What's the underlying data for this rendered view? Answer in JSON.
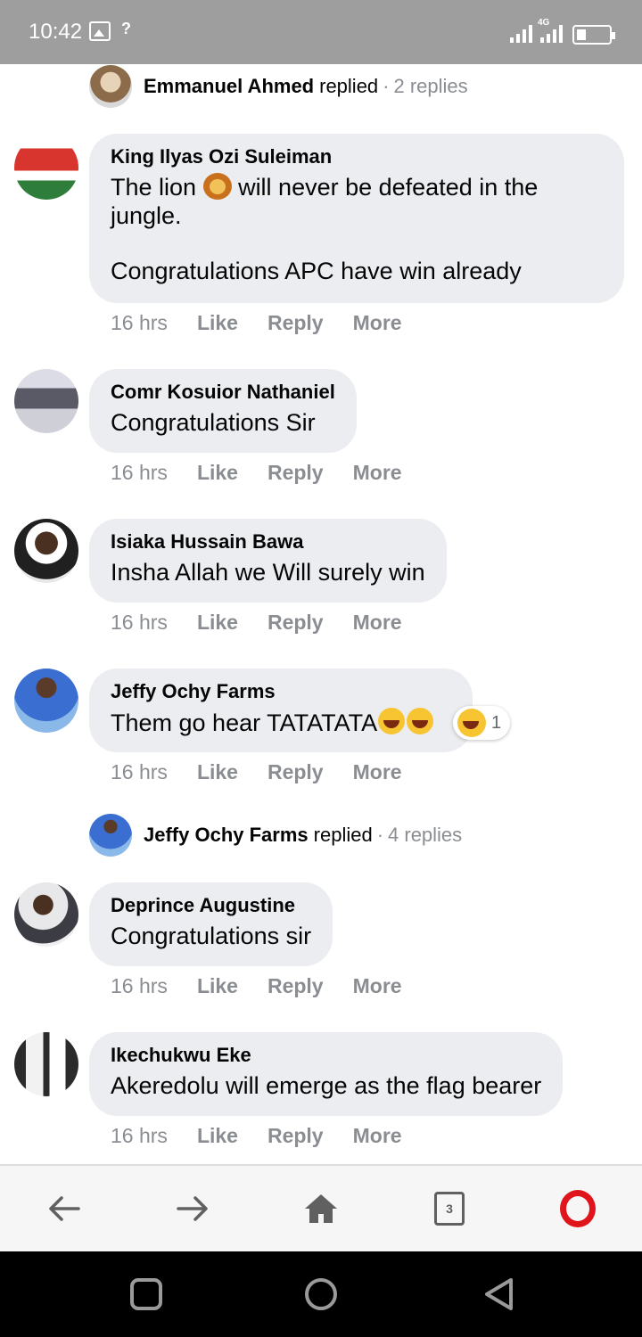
{
  "status_bar": {
    "time": "10:42",
    "network": "4G",
    "colors": {
      "background": "#9e9e9e",
      "foreground": "#ffffff"
    }
  },
  "reply_summaries": [
    {
      "name": "Emmanuel Ahmed",
      "action": "replied",
      "count": "2 replies"
    },
    {
      "name": "Jeffy Ochy Farms",
      "action": "replied",
      "count": "4 replies"
    }
  ],
  "comments": [
    {
      "name": "King Ilyas Ozi Suleiman",
      "text_line1_before": "The lion ",
      "text_line1_after": " will never be defeated in the jungle.",
      "text_line2": "Congratulations APC have win already",
      "time": "16 hrs",
      "like": "Like",
      "reply": "Reply",
      "more": "More"
    },
    {
      "name": "Comr Kosuior Nathaniel",
      "text": "Congratulations Sir",
      "time": "16 hrs",
      "like": "Like",
      "reply": "Reply",
      "more": "More"
    },
    {
      "name": "Isiaka Hussain Bawa",
      "text": "Insha Allah we Will surely win",
      "time": "16 hrs",
      "like": "Like",
      "reply": "Reply",
      "more": "More"
    },
    {
      "name": "Jeffy Ochy Farms",
      "text": "Them go hear TATATATA",
      "reaction_count": "1",
      "time": "16 hrs",
      "like": "Like",
      "reply": "Reply",
      "more": "More"
    },
    {
      "name": "Deprince Augustine",
      "text": "Congratulations sir",
      "time": "16 hrs",
      "like": "Like",
      "reply": "Reply",
      "more": "More"
    },
    {
      "name": "Ikechukwu Eke",
      "text": "Akeredolu will emerge as the flag bearer",
      "time": "16 hrs",
      "like": "Like",
      "reply": "Reply",
      "more": "More"
    }
  ],
  "browser_bar": {
    "tab_count": "3",
    "icons": [
      "back-arrow-icon",
      "forward-arrow-icon",
      "home-icon",
      "tabs-icon",
      "opera-menu-icon"
    ],
    "accent_color": "#e0151b"
  },
  "nav_bar": {
    "icons": [
      "recents-square-icon",
      "home-circle-icon",
      "back-triangle-icon"
    ]
  },
  "colors": {
    "bubble": "#ebedf0",
    "meta_text": "#8a8d91",
    "primary_text": "#050505"
  }
}
